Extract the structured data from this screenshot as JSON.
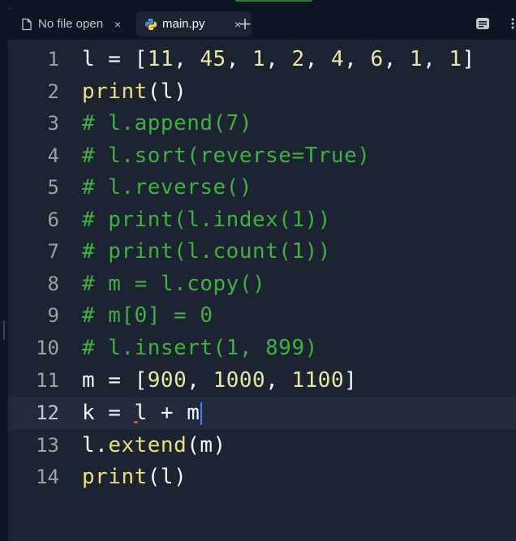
{
  "tabs": [
    {
      "label": "No file open",
      "close": "×",
      "active": false
    },
    {
      "label": "main.py",
      "close": "×",
      "active": true
    }
  ],
  "add_tab_label": "+",
  "icons": {
    "file_icon": "file-outline",
    "python_icon": "python-logo",
    "tools_icon": "panel-tools",
    "more_icon": "more-vertical"
  },
  "colors": {
    "background": "#1c2333",
    "tabbar": "#0e1525",
    "comment": "#3fb23f",
    "number": "#e6e8a3",
    "function": "#ede07b",
    "caret": "#3b82f6"
  },
  "editor": {
    "current_line": 12,
    "lines": [
      {
        "num": "1",
        "text": "l = [11, 45, 1, 2, 4, 6, 1, 1]"
      },
      {
        "num": "2",
        "text": "print(l)"
      },
      {
        "num": "3",
        "text": "# l.append(7)"
      },
      {
        "num": "4",
        "text": "# l.sort(reverse=True)"
      },
      {
        "num": "5",
        "text": "# l.reverse()"
      },
      {
        "num": "6",
        "text": "# print(l.index(1))"
      },
      {
        "num": "7",
        "text": "# print(l.count(1))"
      },
      {
        "num": "8",
        "text": "# m = l.copy()"
      },
      {
        "num": "9",
        "text": "# m[0] = 0"
      },
      {
        "num": "10",
        "text": "# l.insert(1, 899)"
      },
      {
        "num": "11",
        "text": "m = [900, 1000, 1100]"
      },
      {
        "num": "12",
        "text": "k = l + m"
      },
      {
        "num": "13",
        "text": "l.extend(m)"
      },
      {
        "num": "14",
        "text": "print(l)"
      }
    ]
  }
}
